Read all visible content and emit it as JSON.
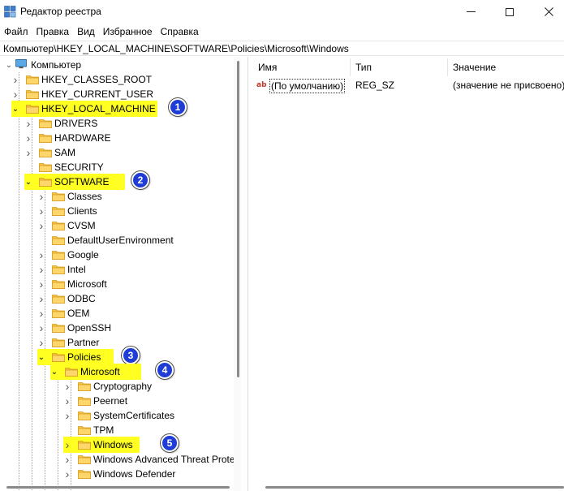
{
  "window": {
    "title": "Редактор реестра",
    "icon": "registry-icon"
  },
  "menu": [
    "Файл",
    "Правка",
    "Вид",
    "Избранное",
    "Справка"
  ],
  "address": "Компьютер\\HKEY_LOCAL_MACHINE\\SOFTWARE\\Policies\\Microsoft\\Windows",
  "tree": {
    "root": "Компьютер",
    "items": [
      {
        "label": "HKEY_CLASSES_ROOT",
        "expanded": false,
        "highlighted": false
      },
      {
        "label": "HKEY_CURRENT_USER",
        "expanded": false,
        "highlighted": false
      },
      {
        "label": "HKEY_LOCAL_MACHINE",
        "expanded": true,
        "highlighted": true,
        "badge": "1"
      },
      {
        "label": "DRIVERS",
        "expanded": false,
        "highlighted": false
      },
      {
        "label": "HARDWARE",
        "expanded": false,
        "highlighted": false
      },
      {
        "label": "SAM",
        "expanded": false,
        "highlighted": false
      },
      {
        "label": "SECURITY",
        "expanded": false,
        "highlighted": false
      },
      {
        "label": "SOFTWARE",
        "expanded": true,
        "highlighted": true,
        "badge": "2"
      },
      {
        "label": "Classes",
        "expanded": false,
        "highlighted": false
      },
      {
        "label": "Clients",
        "expanded": false,
        "highlighted": false
      },
      {
        "label": "CVSM",
        "expanded": false,
        "highlighted": false
      },
      {
        "label": "DefaultUserEnvironment",
        "expanded": false,
        "highlighted": false
      },
      {
        "label": "Google",
        "expanded": false,
        "highlighted": false
      },
      {
        "label": "Intel",
        "expanded": false,
        "highlighted": false
      },
      {
        "label": "Microsoft",
        "expanded": false,
        "highlighted": false
      },
      {
        "label": "ODBC",
        "expanded": false,
        "highlighted": false
      },
      {
        "label": "OEM",
        "expanded": false,
        "highlighted": false
      },
      {
        "label": "OpenSSH",
        "expanded": false,
        "highlighted": false
      },
      {
        "label": "Partner",
        "expanded": false,
        "highlighted": false
      },
      {
        "label": "Policies",
        "expanded": true,
        "highlighted": true,
        "badge": "3"
      },
      {
        "label": "Microsoft",
        "expanded": true,
        "highlighted": true,
        "badge": "4"
      },
      {
        "label": "Cryptography",
        "expanded": false,
        "highlighted": false
      },
      {
        "label": "Peernet",
        "expanded": false,
        "highlighted": false
      },
      {
        "label": "SystemCertificates",
        "expanded": false,
        "highlighted": false
      },
      {
        "label": "TPM",
        "expanded": false,
        "highlighted": false
      },
      {
        "label": "Windows",
        "expanded": false,
        "highlighted": true,
        "badge": "5"
      },
      {
        "label": "Windows Advanced Threat Prote",
        "expanded": false,
        "highlighted": false
      },
      {
        "label": "Windows Defender",
        "expanded": false,
        "highlighted": false
      }
    ]
  },
  "list": {
    "columns": [
      "Имя",
      "Тип",
      "Значение"
    ],
    "rows": [
      {
        "icon": "string-value-icon",
        "icon_text": "ab",
        "name": "(По умолчанию)",
        "type": "REG_SZ",
        "data": "(значение не присвоено)"
      }
    ]
  },
  "colors": {
    "highlight": "#ffff22",
    "badge": "#1f3dd6",
    "folder": "#f5c242"
  }
}
